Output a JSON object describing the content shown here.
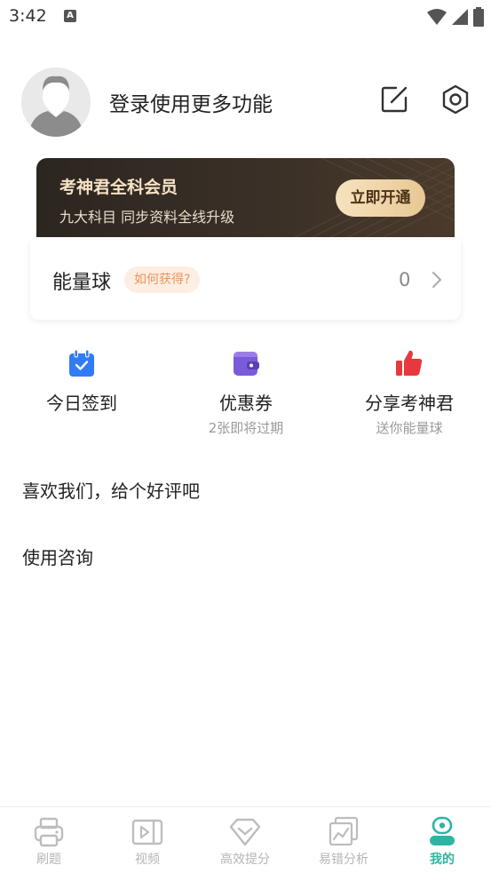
{
  "status_bar": {
    "time": "3:42",
    "notif_letter": "A"
  },
  "profile": {
    "login_text": "登录使用更多功能"
  },
  "vip": {
    "title": "考神君全科会员",
    "subtitle": "九大科目 同步资料全线升级",
    "button": "立即开通"
  },
  "energy": {
    "label": "能量球",
    "how_to_get": "如何获得?",
    "value": "0"
  },
  "quick_actions": [
    {
      "label": "今日签到",
      "sub": "",
      "icon": "calendar-check-icon",
      "color": "#2f7cf6"
    },
    {
      "label": "优惠券",
      "sub": "2张即将过期",
      "icon": "wallet-icon",
      "color": "#7b5bd9"
    },
    {
      "label": "分享考神君",
      "sub": "送你能量球",
      "icon": "thumbs-up-icon",
      "color": "#e8383d"
    }
  ],
  "menu": [
    {
      "label": "喜欢我们，给个好评吧"
    },
    {
      "label": "使用咨询"
    }
  ],
  "tabs": [
    {
      "label": "刷题",
      "icon": "printer-icon",
      "active": false
    },
    {
      "label": "视频",
      "icon": "video-icon",
      "active": false
    },
    {
      "label": "高效提分",
      "icon": "diamond-check-icon",
      "active": false
    },
    {
      "label": "易错分析",
      "icon": "chart-icon",
      "active": false
    },
    {
      "label": "我的",
      "icon": "profile-icon",
      "active": true
    }
  ],
  "colors": {
    "accent": "#2eb5a2",
    "vip_gold": "#f6e3c4",
    "highlight": "#f0935a"
  }
}
